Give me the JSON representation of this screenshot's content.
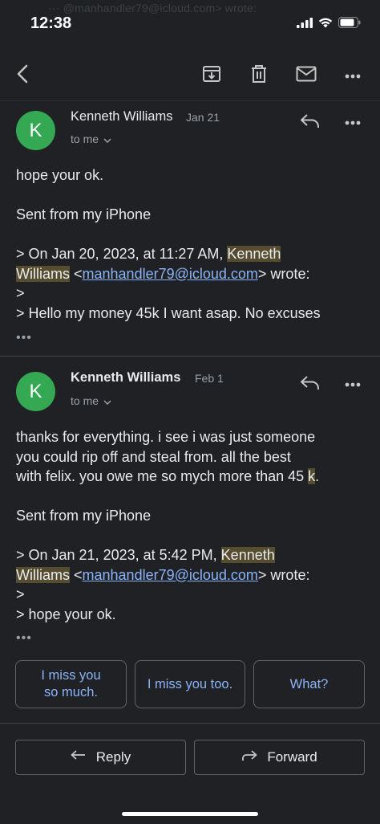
{
  "status_bar": {
    "time": "12:38",
    "ghost_text": "···  @manhandler79@icloud.com>  wrote:",
    "icons": [
      "signal-icon",
      "wifi-icon",
      "battery-icon"
    ]
  },
  "toolbar": {
    "icons": [
      "back-arrow-icon",
      "archive-icon",
      "trash-icon",
      "mark-unread-icon",
      "more-icon"
    ]
  },
  "messages": [
    {
      "avatar_letter": "K",
      "sender": "Kenneth Williams",
      "date": "Jan 21",
      "to_label": "to me",
      "body": {
        "line1": "hope your ok.",
        "signature": "Sent from my iPhone",
        "quote_prefix": "> On Jan 20, 2023, at 11:27 AM, ",
        "quote_name_1": "Kenneth",
        "quote_name_2": "Williams",
        "quote_lt": " <",
        "quote_email": "manhandler79@icloud.com",
        "quote_wrote": "> wrote:",
        "quote_gt": ">",
        "quote_text": "> Hello my money 45k I want asap. No excuses"
      },
      "more_label": "•••"
    },
    {
      "avatar_letter": "K",
      "sender": "Kenneth Williams",
      "date": "Feb 1",
      "to_label": "to me",
      "body": {
        "line1": "thanks for everything. i see i was just someone",
        "line2": "you could rip off and steal from. all the best",
        "line3_a": "with felix. you owe me so mych more than 45 ",
        "line3_hl": "k",
        "line3_b": ".",
        "signature": "Sent from my iPhone",
        "quote_prefix": "> On Jan 21, 2023, at 5:42 PM, ",
        "quote_name_1": "Kenneth",
        "quote_name_2": "Williams",
        "quote_lt": " <",
        "quote_email": "manhandler79@icloud.com",
        "quote_wrote": "> wrote:",
        "quote_gt": ">",
        "quote_text": "> hope your ok."
      },
      "more_label": "•••"
    }
  ],
  "smart_replies": {
    "reply_1_line1": "I miss you",
    "reply_1_line2": "so much.",
    "reply_2": "I miss you too.",
    "reply_3": "What?"
  },
  "actions": {
    "reply_label": "Reply",
    "forward_label": "Forward"
  },
  "colors": {
    "background": "#202124",
    "accent_link": "#8ab4f8",
    "avatar": "#34a853",
    "highlight": "#564d30"
  }
}
